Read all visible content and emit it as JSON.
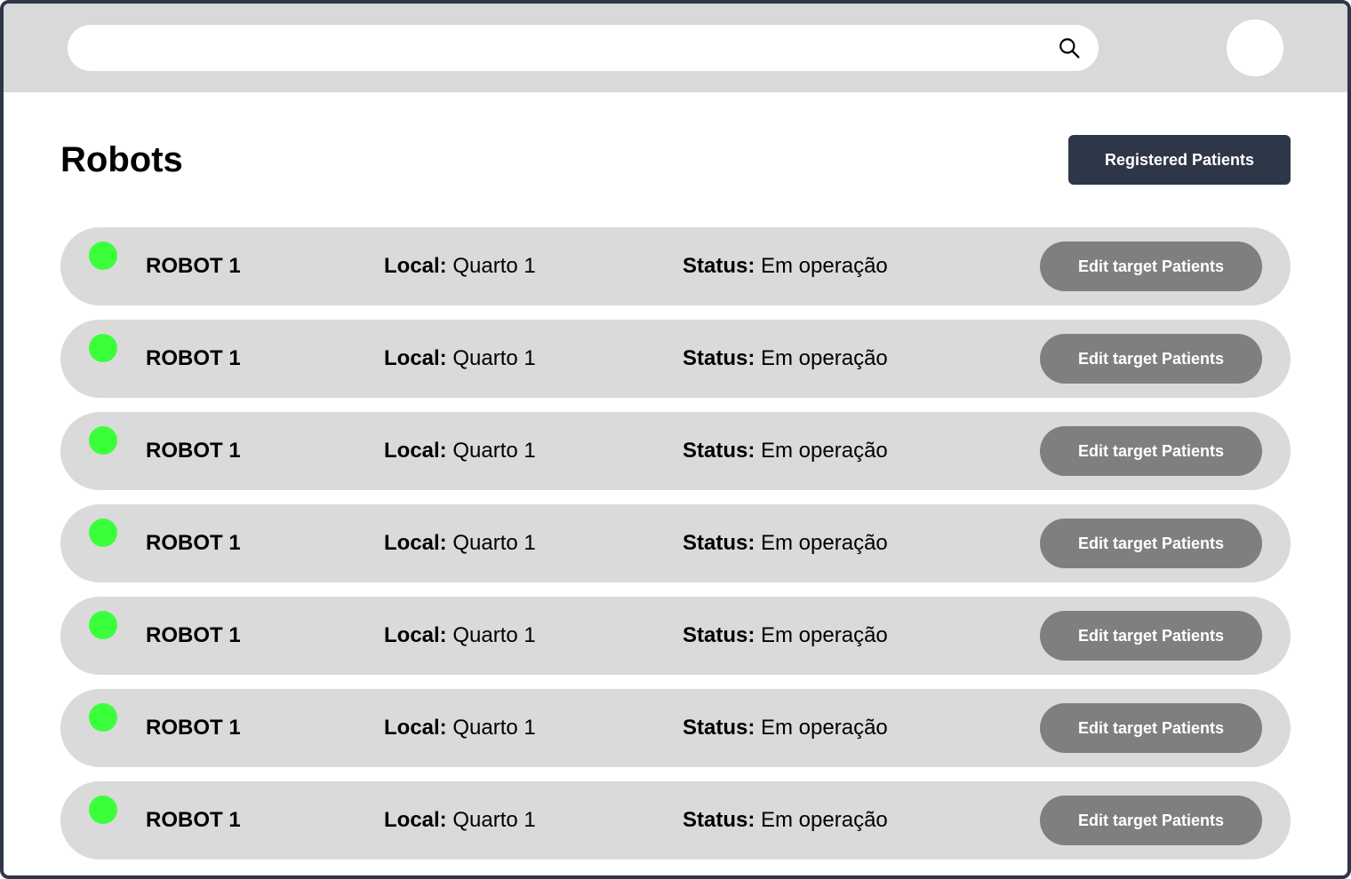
{
  "search": {
    "placeholder": "",
    "value": ""
  },
  "icons": {
    "search": "search-icon",
    "avatar": "avatar"
  },
  "page": {
    "title": "Robots"
  },
  "header_button": {
    "label": "Registered Patients"
  },
  "colors": {
    "frame": "#2e3748",
    "topbar": "#d9d9d9",
    "row_bg": "#dadada",
    "status_online": "#3cff3c",
    "primary_button": "#2e3748",
    "secondary_button": "#7f7f7f"
  },
  "robots": [
    {
      "name": "ROBOT 1",
      "local_label": "Local:",
      "local_value": "Quarto 1",
      "status_label": "Status:",
      "status_value": "Em operação",
      "action_label": "Edit target Patients",
      "online": true
    },
    {
      "name": "ROBOT 1",
      "local_label": "Local:",
      "local_value": "Quarto 1",
      "status_label": "Status:",
      "status_value": "Em operação",
      "action_label": "Edit target Patients",
      "online": true
    },
    {
      "name": "ROBOT 1",
      "local_label": "Local:",
      "local_value": "Quarto 1",
      "status_label": "Status:",
      "status_value": "Em operação",
      "action_label": "Edit target Patients",
      "online": true
    },
    {
      "name": "ROBOT 1",
      "local_label": "Local:",
      "local_value": "Quarto 1",
      "status_label": "Status:",
      "status_value": "Em operação",
      "action_label": "Edit target Patients",
      "online": true
    },
    {
      "name": "ROBOT 1",
      "local_label": "Local:",
      "local_value": "Quarto 1",
      "status_label": "Status:",
      "status_value": "Em operação",
      "action_label": "Edit target Patients",
      "online": true
    },
    {
      "name": "ROBOT 1",
      "local_label": "Local:",
      "local_value": "Quarto 1",
      "status_label": "Status:",
      "status_value": "Em operação",
      "action_label": "Edit target Patients",
      "online": true
    },
    {
      "name": "ROBOT 1",
      "local_label": "Local:",
      "local_value": "Quarto 1",
      "status_label": "Status:",
      "status_value": "Em operação",
      "action_label": "Edit target Patients",
      "online": true
    }
  ]
}
